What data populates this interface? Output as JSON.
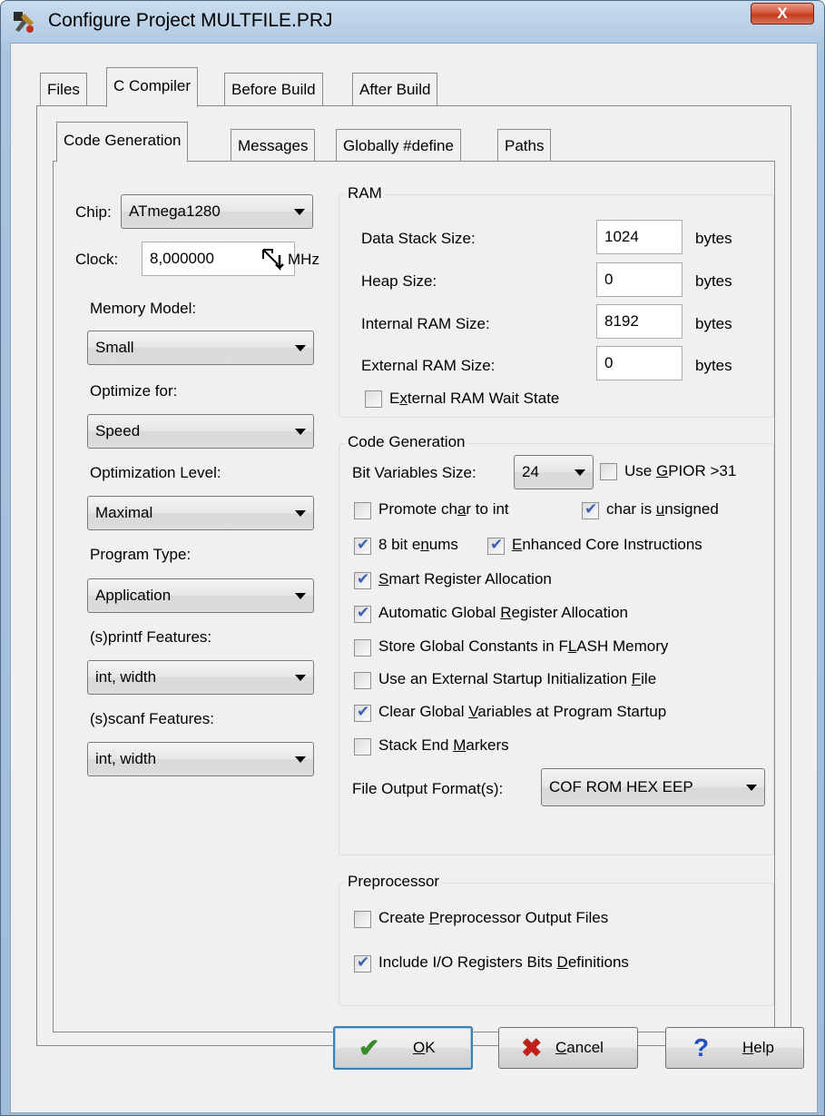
{
  "window": {
    "title": "Configure Project MULTFILE.PRJ",
    "close_label": "X"
  },
  "main_tabs": [
    "Files",
    "C Compiler",
    "Before Build",
    "After Build"
  ],
  "sub_tabs": [
    "Code Generation",
    "Messages",
    "Globally #define",
    "Paths"
  ],
  "left": {
    "chip_label": "Chip:",
    "chip_value": "ATmega1280",
    "clock_label": "Clock:",
    "clock_value": "8,000000",
    "clock_unit": "MHz",
    "memory_model_label": "Memory Model:",
    "memory_model_value": "Small",
    "optimize_for_label": "Optimize for:",
    "optimize_for_value": "Speed",
    "opt_level_label": "Optimization Level:",
    "opt_level_value": "Maximal",
    "program_type_label": "Program Type:",
    "program_type_value": "Application",
    "printf_label": "(s)printf Features:",
    "printf_value": "int, width",
    "scanf_label": "(s)scanf Features:",
    "scanf_value": "int, width"
  },
  "ram": {
    "legend": "RAM",
    "data_stack_label": "Data Stack Size:",
    "data_stack_value": "1024",
    "heap_label": "Heap Size:",
    "heap_value": "0",
    "internal_label": "Internal RAM Size:",
    "internal_value": "8192",
    "external_label": "External RAM Size:",
    "external_value": "0",
    "unit": "bytes",
    "wait_state_pre": "E",
    "wait_state_ul": "x",
    "wait_state_post": "ternal RAM Wait State"
  },
  "codegen": {
    "legend": "Code Generation",
    "bitvar_label": "Bit Variables Size:",
    "bitvar_value": "24",
    "gpior_pre": "Use ",
    "gpior_ul": "G",
    "gpior_post": "PIOR >31",
    "promote_pre": "Promote ch",
    "promote_ul": "a",
    "promote_post": "r to int",
    "unsigned_pre": "char is ",
    "unsigned_ul": "u",
    "unsigned_post": "nsigned",
    "enums_pre": "8 bit e",
    "enums_ul": "n",
    "enums_post": "ums",
    "enhanced_pre": "",
    "enhanced_ul": "E",
    "enhanced_post": "nhanced Core Instructions",
    "smart_pre": "",
    "smart_ul": "S",
    "smart_post": "mart Register Allocation",
    "auto_pre": "Automatic Global ",
    "auto_ul": "R",
    "auto_post": "egister Allocation",
    "flash_pre": "Store Global Constants in F",
    "flash_ul": "L",
    "flash_post": "ASH Memory",
    "startup_pre": "Use an External Startup Initialization ",
    "startup_ul": "F",
    "startup_post": "ile",
    "clear_pre": "Clear Global ",
    "clear_ul": "V",
    "clear_post": "ariables at Program Startup",
    "markers_pre": "Stack End ",
    "markers_ul": "M",
    "markers_post": "arkers",
    "output_label": "File Output Format(s):",
    "output_value": "COF ROM HEX EEP"
  },
  "pre": {
    "legend": "Preprocessor",
    "create_pre": "Create ",
    "create_ul": "P",
    "create_post": "reprocessor Output Files",
    "include_pre": "Include I/O Registers Bits ",
    "include_ul": "D",
    "include_post": "efinitions"
  },
  "buttons": {
    "ok_ul": "O",
    "ok_post": "K",
    "cancel_ul": "C",
    "cancel_post": "ancel",
    "help_ul": "H",
    "help_post": "elp"
  },
  "colors": {
    "ok_icon": "#3a8a2a",
    "cancel_icon": "#c0201a",
    "help_icon": "#1f4fc2",
    "check": "#4061b3"
  }
}
